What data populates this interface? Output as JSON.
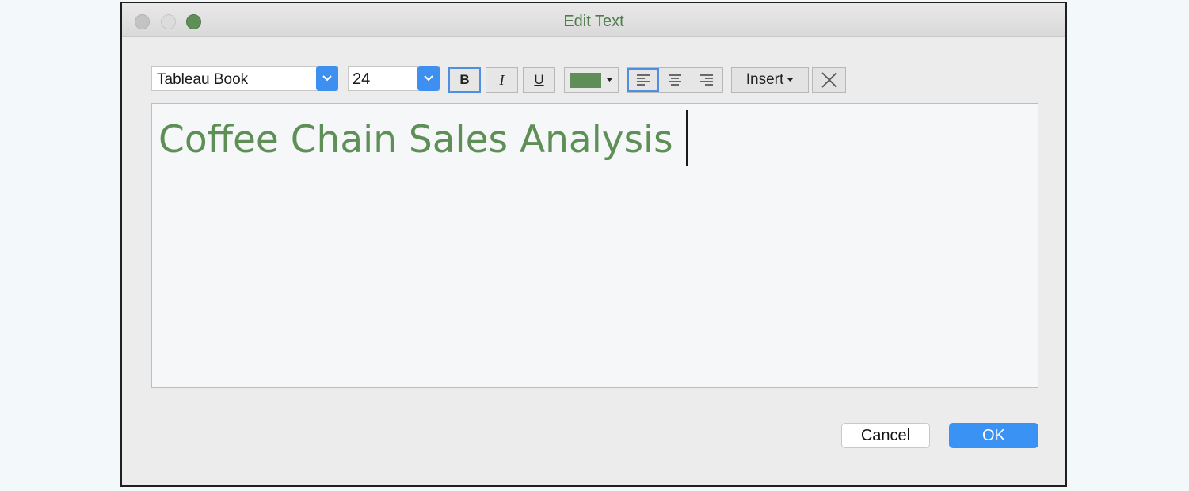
{
  "window": {
    "title": "Edit Text"
  },
  "toolbar": {
    "font": {
      "value": "Tableau Book"
    },
    "size": {
      "value": "24"
    },
    "bold_label": "B",
    "italic_label": "I",
    "underline_label": "U",
    "color": "#5e8f57",
    "insert_label": "Insert"
  },
  "editor": {
    "text": "Coffee Chain Sales Analysis"
  },
  "footer": {
    "cancel_label": "Cancel",
    "ok_label": "OK"
  },
  "icons": [
    "chevron-down-icon",
    "caret-down-icon",
    "align-left-icon",
    "align-center-icon",
    "align-right-icon",
    "clear-format-icon"
  ]
}
